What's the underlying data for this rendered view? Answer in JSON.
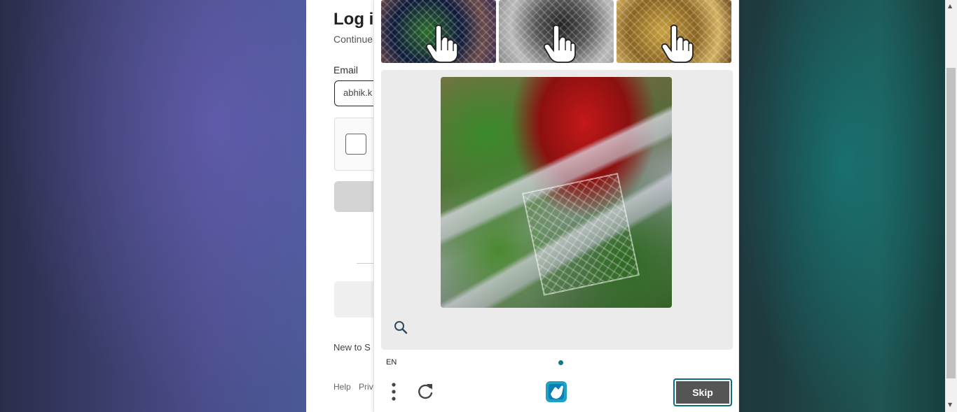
{
  "login": {
    "title": "Log i",
    "subtitle": "Continue",
    "email_label": "Email",
    "email_value": "abhik.k",
    "new_to": "New to S",
    "footer": {
      "help": "Help",
      "privacy": "Priva"
    }
  },
  "captcha": {
    "language": "EN",
    "skip_label": "Skip",
    "icons": {
      "examples": "hand-pointer-icon",
      "zoom": "search-icon",
      "menu": "kebab-menu-icon",
      "refresh": "refresh-icon",
      "logo": "hcaptcha-logo-icon"
    },
    "colors": {
      "accent": "#0a7a8a",
      "skip_bg": "#555555"
    }
  }
}
